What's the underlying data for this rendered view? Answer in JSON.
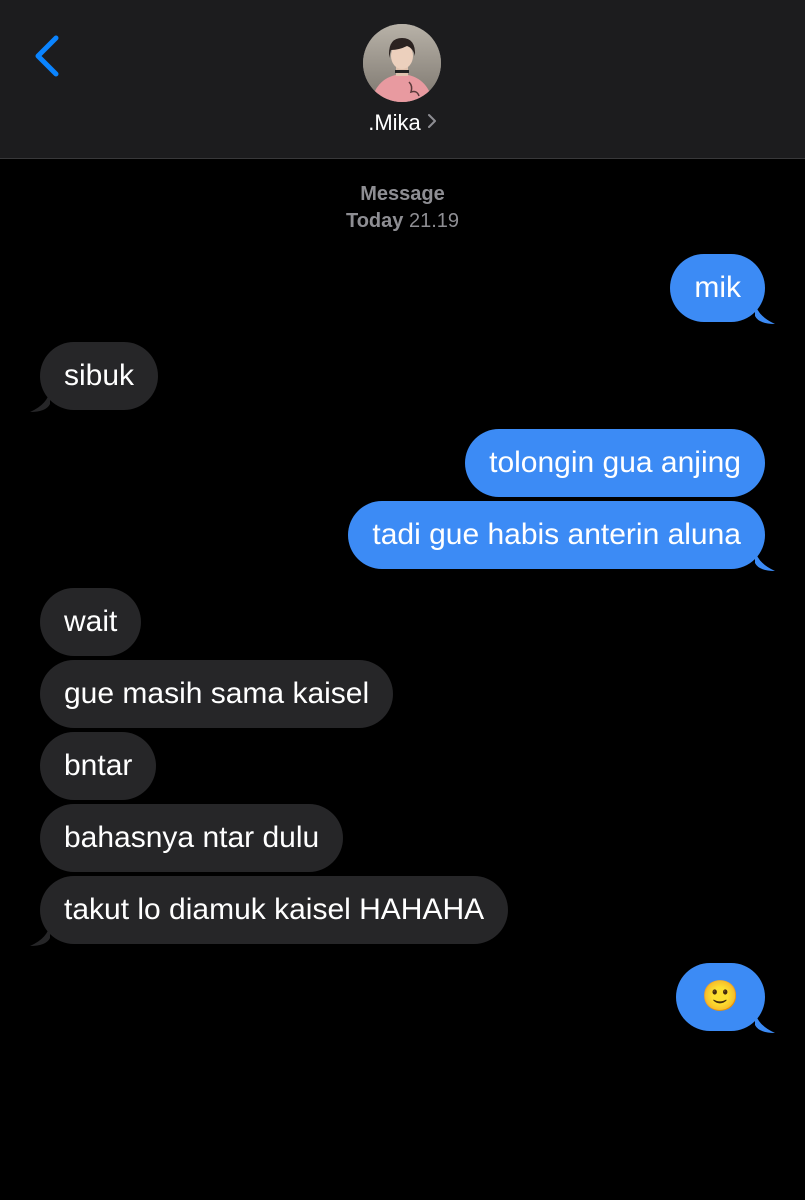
{
  "header": {
    "back_icon": "chevron-left-icon",
    "contact_name": ".Mika",
    "avatar": "contact-avatar",
    "accent_color": "#0a84ff"
  },
  "thread": {
    "service": "Message",
    "day": "Today",
    "time": "21.19"
  },
  "messages": [
    {
      "direction": "outgoing",
      "text": "mik"
    },
    {
      "direction": "incoming",
      "text": "sibuk"
    },
    {
      "direction": "outgoing",
      "text": "tolongin gua anjing"
    },
    {
      "direction": "outgoing",
      "text": "tadi gue habis anterin aluna"
    },
    {
      "direction": "incoming",
      "text": "wait"
    },
    {
      "direction": "incoming",
      "text": "gue masih sama kaisel"
    },
    {
      "direction": "incoming",
      "text": "bntar"
    },
    {
      "direction": "incoming",
      "text": "bahasnya ntar dulu"
    },
    {
      "direction": "incoming",
      "text": "takut lo diamuk kaisel HAHAHA"
    },
    {
      "direction": "outgoing",
      "text": "🙂"
    }
  ],
  "colors": {
    "outgoing_bubble": "#3c8bf5",
    "incoming_bubble": "#262628",
    "header_bg": "#1c1c1e",
    "meta_text": "#8e8e93"
  }
}
